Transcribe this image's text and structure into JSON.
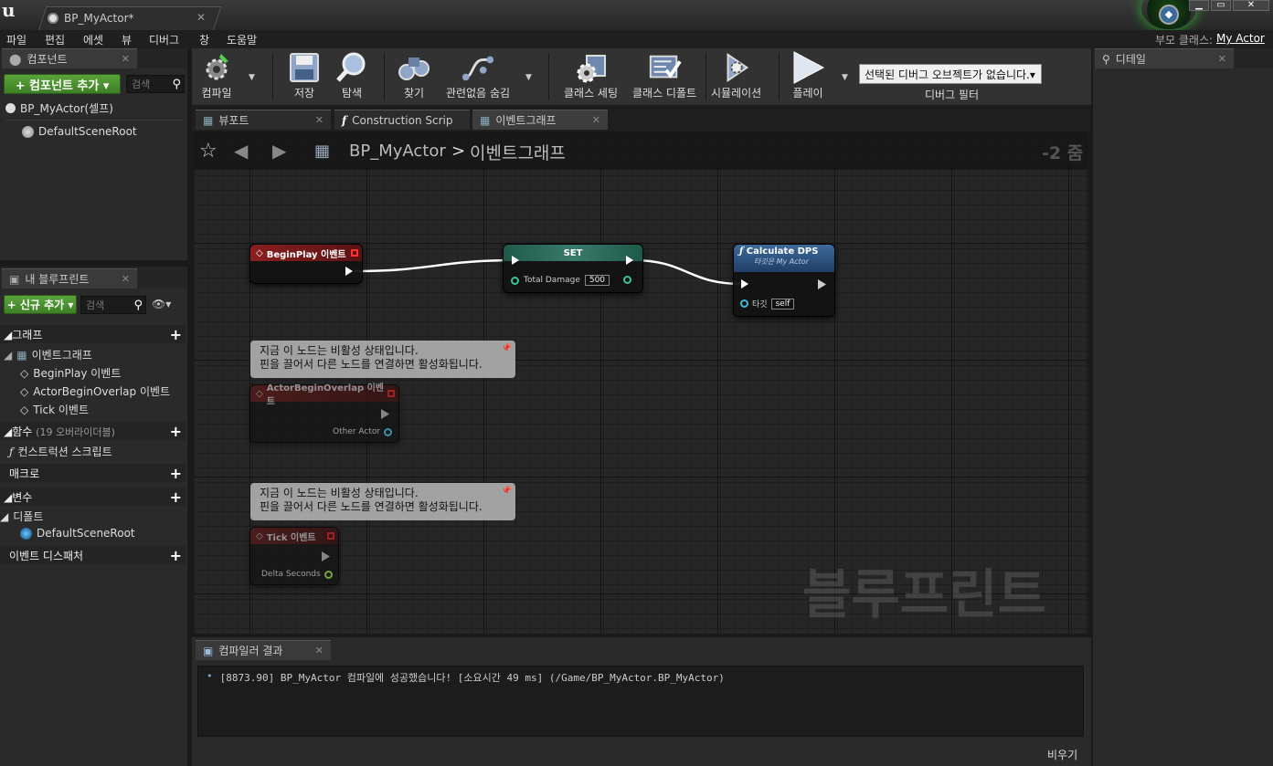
{
  "window": {
    "doc_tab": "BP_MyActor*",
    "min": "▁",
    "max": "▭",
    "close": "✕"
  },
  "menu": [
    "파일",
    "편집",
    "에셋",
    "뷰",
    "디버그",
    "창",
    "도움말"
  ],
  "parent_class": {
    "label": "부모 클래스:",
    "value": "My Actor"
  },
  "components_panel": {
    "tab": "컴포넌트",
    "add_button": "+ 컴포넌트 추가 ▾",
    "search_placeholder": "검색",
    "items": [
      "BP_MyActor(셀프)",
      "DefaultSceneRoot"
    ]
  },
  "blueprint_panel": {
    "tab": "내 블루프린트",
    "add_button": "+ 신규 추가 ▾",
    "search_placeholder": "검색",
    "graph_category": "그래프",
    "event_graph": "이벤트그래프",
    "events": [
      "BeginPlay 이벤트",
      "ActorBeginOverlap 이벤트",
      "Tick 이벤트"
    ],
    "functions_category": "함수",
    "functions_note": "(19 오버라이더블)",
    "construction_script": "컨스트럭션 스크립트",
    "macros_category": "매크로",
    "variables_category": "변수",
    "defaults_category": "디폴트",
    "default_scene_root": "DefaultSceneRoot",
    "dispatchers_category": "이벤트 디스패처"
  },
  "toolbar": {
    "compile": "컴파일",
    "save": "저장",
    "browse": "탐색",
    "find": "찾기",
    "hide_unrelated": "관련없음 숨김",
    "class_settings": "클래스 세팅",
    "class_defaults": "클래스 디폴트",
    "simulation": "시뮬레이션",
    "play": "플레이",
    "debug_select": "선택된 디버그 오브젝트가 없습니다.▾",
    "debug_filter": "디버그 필터"
  },
  "editor_tabs": [
    "뷰포트",
    "Construction Scrip",
    "이벤트그래프"
  ],
  "graph": {
    "breadcrumb_root": "BP_MyActor",
    "breadcrumb_sep": ">",
    "breadcrumb_current": "이벤트그래프",
    "zoom": "-2 줌",
    "watermark": "블루프린트",
    "nodes": {
      "beginplay": {
        "title": "BeginPlay 이벤트"
      },
      "set": {
        "title": "SET",
        "pin": "Total Damage",
        "value": "500"
      },
      "calc": {
        "title": "Calculate DPS",
        "subtitle": "타깃은 My Actor",
        "target_pin": "타깃",
        "target_value": "self"
      },
      "overlap": {
        "title": "ActorBeginOverlap 이벤트",
        "pin": "Other Actor"
      },
      "tick": {
        "title": "Tick 이벤트",
        "pin": "Delta Seconds"
      }
    },
    "comment_line1": "지금 이 노드는 비활성 상태입니다.",
    "comment_line2": "핀을 끌어서 다른 노드를 연결하면 활성화됩니다."
  },
  "details_panel": {
    "tab": "디테일"
  },
  "compiler": {
    "tab": "컴파일러 결과",
    "message": "[8873.90] BP_MyActor 컴파일에 성공했습니다! [소요시간 49 ms] (/Game/BP_MyActor.BP_MyActor)",
    "clear": "비우기"
  }
}
